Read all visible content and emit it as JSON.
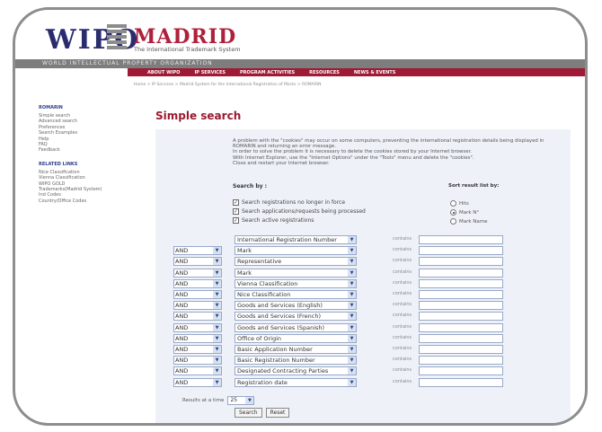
{
  "header": {
    "logo_text": "WIPO",
    "app_title": "MADRID",
    "app_subtitle": "The International Trademark System",
    "org_bar": "WORLD INTELLECTUAL PROPERTY ORGANIZATION"
  },
  "nav": [
    "ABOUT WIPO",
    "IP SERVICES",
    "PROGRAM ACTIVITIES",
    "RESOURCES",
    "NEWS & EVENTS"
  ],
  "breadcrumb": "Home > IP Services > Madrid System for the International Registration of Marks > ROMARIN",
  "sidebar": {
    "section1_title": "ROMARIN",
    "section1_items": [
      "Simple search",
      "Advanced search",
      "Preferences",
      "Search Examples",
      "Help",
      "FAQ",
      "Feedback"
    ],
    "section2_title": "RELATED LINKS",
    "section2_items": [
      "Nice Classification",
      "Vienna Classification",
      "WIPO GOLD",
      "Trademarks(Madrid System)",
      "Ind Codes",
      "Country/Office Codes"
    ]
  },
  "page": {
    "title": "Simple search"
  },
  "notice": [
    "A problem with the \"cookies\" may occur on some computers, preventing the international registration details being displayed in ROMARIN and returning an error message.",
    "In order to solve the problem it is necessary to delete the cookies stored by your Internet browser.",
    "With Internet Explorer, use the \"Internet Options\" under the \"Tools\" menu and delete the \"cookies\".",
    "Close and restart your Internet browser."
  ],
  "search_by": {
    "label": "Search by :",
    "options": [
      {
        "label": "Search registrations no longer in force",
        "checked": true
      },
      {
        "label": "Search applications/requests being processed",
        "checked": true
      },
      {
        "label": "Search active registrations",
        "checked": true
      }
    ]
  },
  "sort": {
    "label": "Sort result list by:",
    "options": [
      {
        "label": "Hits",
        "selected": false
      },
      {
        "label": "Mark N°",
        "selected": true
      },
      {
        "label": "Mark Name",
        "selected": false
      }
    ]
  },
  "criteria": {
    "contains_label": "contains",
    "rows": [
      {
        "op": "",
        "field": "International Registration Number"
      },
      {
        "op": "AND",
        "field": "Mark"
      },
      {
        "op": "AND",
        "field": "Representative"
      },
      {
        "op": "AND",
        "field": "Mark"
      },
      {
        "op": "AND",
        "field": "Vienna Classification"
      },
      {
        "op": "AND",
        "field": "Nice Classification"
      },
      {
        "op": "AND",
        "field": "Goods and Services (English)"
      },
      {
        "op": "AND",
        "field": "Goods and Services (French)"
      },
      {
        "op": "AND",
        "field": "Goods and Services (Spanish)"
      },
      {
        "op": "AND",
        "field": "Office of Origin"
      },
      {
        "op": "AND",
        "field": "Basic Application Number"
      },
      {
        "op": "AND",
        "field": "Basic Registration Number"
      },
      {
        "op": "AND",
        "field": "Designated Contracting Parties"
      },
      {
        "op": "AND",
        "field": "Registration date"
      }
    ]
  },
  "results": {
    "label": "Results at a time",
    "value": "25"
  },
  "buttons": {
    "search": "Search",
    "reset": "Reset"
  },
  "colors": {
    "accent": "#9a1a30",
    "nav_bg": "#9e1a35",
    "panel_bg": "#eef2f8"
  }
}
